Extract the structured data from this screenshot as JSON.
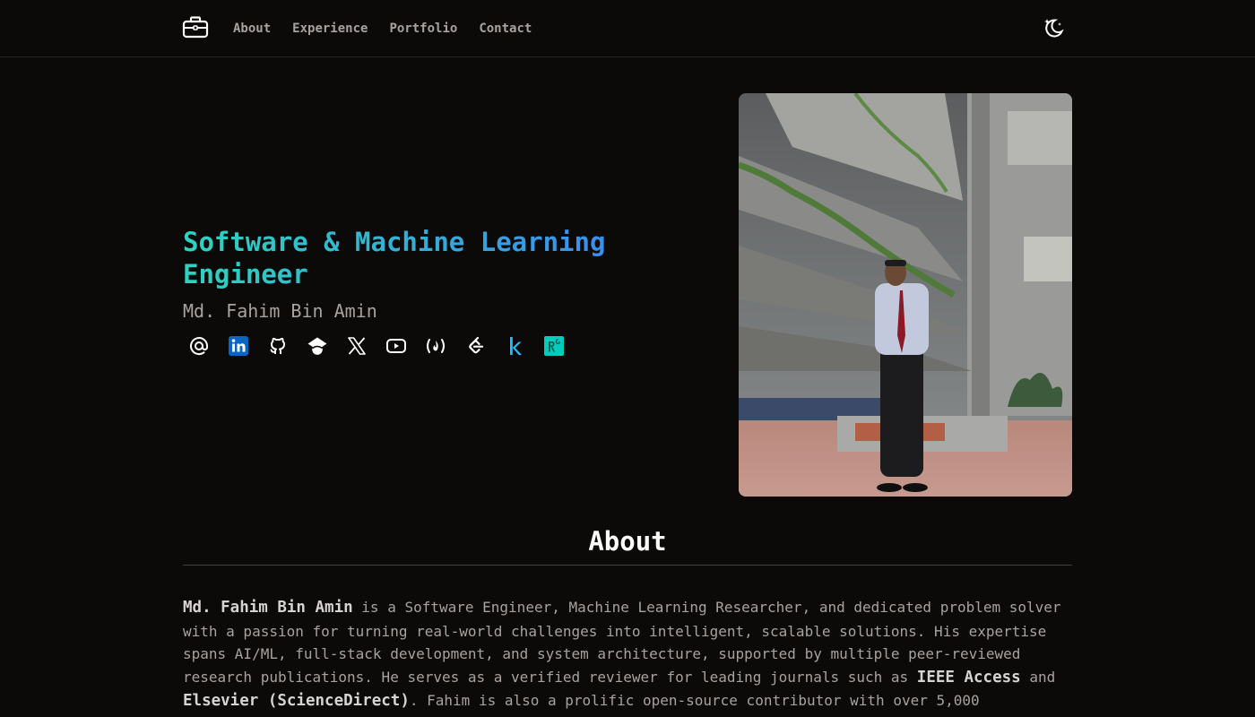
{
  "nav": {
    "logo_icon": "briefcase-icon",
    "links": [
      {
        "label": "About"
      },
      {
        "label": "Experience"
      },
      {
        "label": "Portfolio"
      },
      {
        "label": "Contact"
      }
    ],
    "theme_toggle_icon": "moon-stars-icon"
  },
  "hero": {
    "title": "Software & Machine Learning Engineer",
    "name": "Md. Fahim Bin Amin",
    "socials": [
      {
        "icon": "email-at-icon"
      },
      {
        "icon": "linkedin-icon"
      },
      {
        "icon": "github-icon"
      },
      {
        "icon": "google-scholar-icon"
      },
      {
        "icon": "x-twitter-icon"
      },
      {
        "icon": "youtube-icon"
      },
      {
        "icon": "freecodecamp-icon"
      },
      {
        "icon": "leetcode-icon"
      },
      {
        "icon": "kaggle-icon"
      },
      {
        "icon": "researchgate-icon"
      }
    ],
    "photo_alt": "portrait-photo"
  },
  "about": {
    "heading": "About",
    "p1": "Md. Fahim Bin Amin",
    "p2": " is a Software Engineer, Machine Learning Researcher, and dedicated problem solver with a passion for turning real-world challenges into intelligent, scalable solutions. His expertise spans AI/ML, full-stack development, and system architecture, supported by multiple peer-reviewed research publications. He serves as a verified reviewer for leading journals such as ",
    "p3": "IEEE Access",
    "p4": " and ",
    "p5": "Elsevier (ScienceDirect)",
    "p6": ". Fahim is also a prolific open-source contributor with over 5,000"
  },
  "colors": {
    "background": "#0c0a09",
    "gradient_start": "#2dd4bf",
    "gradient_end": "#3b82f6",
    "linkedin_blue": "#0a66c2",
    "kaggle_blue": "#20beff",
    "researchgate_teal": "#00ccbb"
  }
}
